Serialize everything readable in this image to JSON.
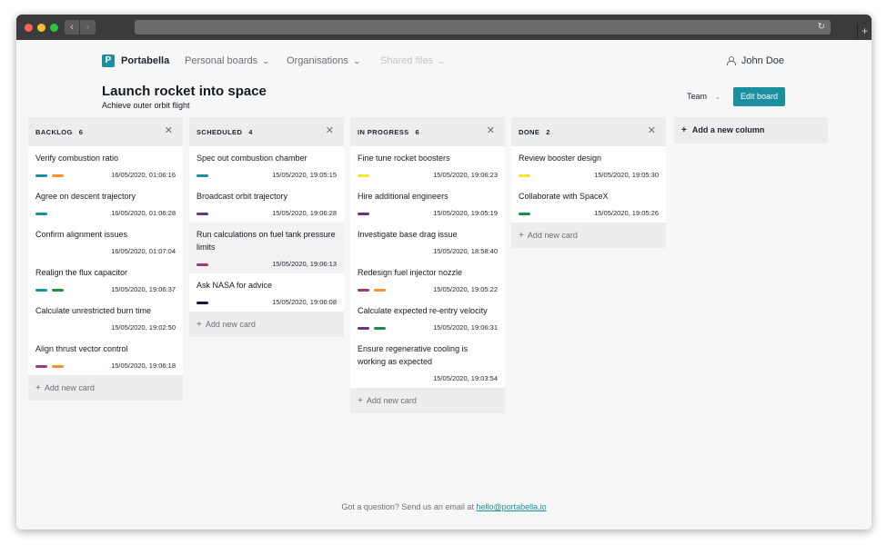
{
  "app": {
    "brand": "Portabella",
    "logo_letter": "P",
    "nav": [
      {
        "label": "Personal boards",
        "disabled": false
      },
      {
        "label": "Organisations",
        "disabled": false
      },
      {
        "label": "Shared files",
        "disabled": true
      }
    ],
    "user_name": "John Doe"
  },
  "board": {
    "title": "Launch rocket into space",
    "subtitle": "Achieve outer orbit flight",
    "team_label": "Team",
    "edit_label": "Edit board"
  },
  "label_colors": {
    "teal": "#1b8f9e",
    "orange": "#f7932f",
    "green": "#1e8a4c",
    "purple": "#5b3b86",
    "magenta": "#a13a6c",
    "yellow": "#f3e53b",
    "navy": "#141a3a"
  },
  "columns": [
    {
      "name": "BACKLOG",
      "count": "6",
      "cards": [
        {
          "title": "Verify combustion ratio",
          "labels": [
            "teal",
            "orange"
          ],
          "date": "16/05/2020, 01:06:16"
        },
        {
          "title": "Agree on descent trajectory",
          "labels": [
            "teal"
          ],
          "date": "16/05/2020, 01:06:28"
        },
        {
          "title": "Confirm alignment issues",
          "labels": [],
          "date": "16/05/2020, 01:07:04"
        },
        {
          "title": "Realign the flux capacitor",
          "labels": [
            "teal",
            "green"
          ],
          "date": "15/05/2020, 19:06:37"
        },
        {
          "title": "Calculate unrestricted burn time",
          "labels": [],
          "date": "15/05/2020, 19:02:50"
        },
        {
          "title": "Align thrust vector control",
          "labels": [
            "magenta",
            "orange"
          ],
          "date": "15/05/2020, 19:06:18"
        }
      ],
      "add_label": "Add new card"
    },
    {
      "name": "SCHEDULED",
      "count": "4",
      "cards": [
        {
          "title": "Spec out combustion chamber",
          "labels": [
            "teal"
          ],
          "date": "15/05/2020, 19:05:15"
        },
        {
          "title": "Broadcast orbit trajectory",
          "labels": [
            "purple"
          ],
          "date": "15/05/2020, 19:06:28"
        },
        {
          "title": "Run calculations on fuel tank pressure limits",
          "labels": [
            "magenta"
          ],
          "date": "15/05/2020, 19:06:13",
          "highlight": true
        },
        {
          "title": "Ask NASA for advice",
          "labels": [
            "navy"
          ],
          "date": "15/05/2020, 19:06:08"
        }
      ],
      "add_label": "Add new card"
    },
    {
      "name": "IN PROGRESS",
      "count": "6",
      "cards": [
        {
          "title": "Fine tune rocket boosters",
          "labels": [
            "yellow"
          ],
          "date": "15/05/2020, 19:06:23"
        },
        {
          "title": "Hire additional engineers",
          "labels": [
            "purple"
          ],
          "date": "15/05/2020, 19:05:19"
        },
        {
          "title": "Investigate base drag issue",
          "labels": [],
          "date": "15/05/2020, 18:58:40"
        },
        {
          "title": "Redesign fuel injector nozzle",
          "labels": [
            "magenta",
            "orange"
          ],
          "date": "15/05/2020, 19:05:22"
        },
        {
          "title": "Calculate expected re-entry velocity",
          "labels": [
            "purple",
            "green"
          ],
          "date": "15/05/2020, 19:06:31"
        },
        {
          "title": "Ensure regenerative cooling is working as expected",
          "labels": [],
          "date": "15/05/2020, 19:03:54"
        }
      ],
      "add_label": "Add new card"
    },
    {
      "name": "DONE",
      "count": "2",
      "cards": [
        {
          "title": "Review booster design",
          "labels": [
            "yellow"
          ],
          "date": "15/05/2020, 19:05:30"
        },
        {
          "title": "Collaborate with SpaceX",
          "labels": [
            "green"
          ],
          "date": "15/05/2020, 19:05:26"
        }
      ],
      "add_label": "Add new card"
    }
  ],
  "add_column_label": "Add a new column",
  "footer": {
    "text": "Got a question? Send us an email at",
    "email": "hello@portabella.io"
  }
}
